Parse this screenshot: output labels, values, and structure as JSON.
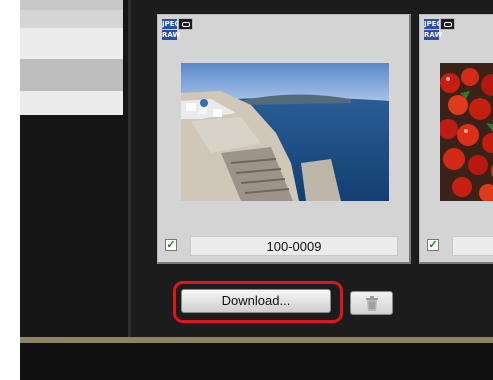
{
  "left_panel": {
    "rows": 4
  },
  "thumbnails": [
    {
      "badges": {
        "jpeg": "JPEG",
        "raw": "RAW"
      },
      "filename": "100-0009",
      "checked": true,
      "checkmark": "✓"
    },
    {
      "badges": {
        "jpeg": "JPEG",
        "raw": "RAW"
      },
      "filename": "",
      "checked": true,
      "checkmark": "✓"
    }
  ],
  "toolbar": {
    "download_label": "Download..."
  },
  "colors": {
    "highlight": "#e0141b",
    "badge_blue": "#2a4fa6",
    "check_green": "#1b8a1b"
  }
}
